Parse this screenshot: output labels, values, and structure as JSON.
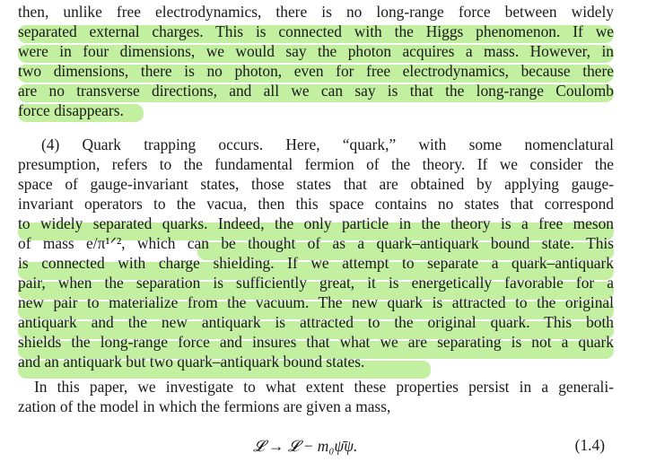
{
  "document": {
    "paragraph1": [
      "then, unlike free electrodynamics, there is no long-range force between widely",
      "separated external charges. This is connected with the Higgs phenomenon. If we",
      "were in four dimensions, we would say the photon acquires a mass. However, in",
      "two dimensions, there is no photon, even for free electrodynamics, because there",
      "are no transverse directions, and all we can say is that the long-range Coulomb",
      "force disappears."
    ],
    "paragraph2": [
      "(4)  Quark  trapping  occurs.  Here,  “quark,”  with  some  nomenclatural",
      "presumption, refers to the fundamental fermion of the theory. If we consider the",
      "space of gauge-invariant states, those states that are obtained by applying gauge-",
      "invariant operators to the vacua, then this space contains no states that correspond",
      "to widely separated quarks. Indeed, the only particle in the theory is a free meson",
      "of mass e/π¹ᐟ², which can be thought of as a quark–antiquark bound state. This",
      "is connected with charge shielding. If we attempt to separate a quark–antiquark",
      "pair, when the separation is sufficiently great, it is energetically favorable for a",
      "new pair to materialize from the vacuum. The new quark is attracted to the original",
      "antiquark and the new antiquark is attracted to the original quark. This both",
      "shields the long-range force and insures that what we are separating is not a quark",
      "and an antiquark but two quark–antiquark bound states."
    ],
    "paragraph3": [
      "In this paper, we investigate to what extent these properties persist in a generali-",
      "zation of the model in which the fermions are given a mass,"
    ],
    "equation": "𝓛 → 𝓛 − m₀ψ̄ψ.",
    "equation_number": "(1.4)",
    "highlight_color": "#b9ec8f"
  }
}
